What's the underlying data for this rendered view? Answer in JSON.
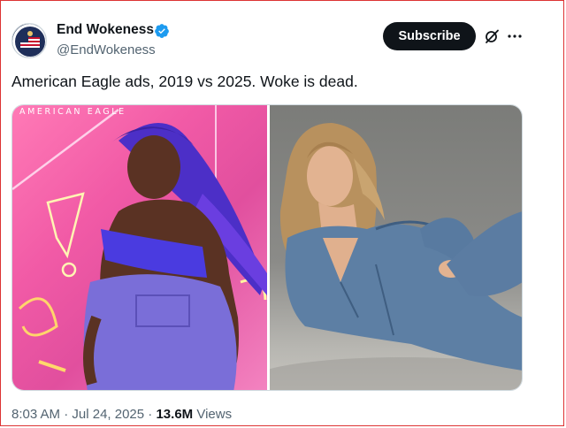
{
  "author": {
    "display_name": "End Wokeness",
    "handle": "@EndWokeness",
    "verified": true,
    "verified_color": "#1d9bf0"
  },
  "actions": {
    "subscribe_label": "Subscribe",
    "grok_icon": "grok-icon",
    "more_icon": "more-icon"
  },
  "tweet": {
    "text": "American Eagle ads, 2019 vs 2025. Woke is dead."
  },
  "media": {
    "left_brand_text": "AMERICAN EAGLE"
  },
  "meta": {
    "time": "8:03 AM",
    "date": "Jul 24, 2025",
    "views_count": "13.6M",
    "views_label": "Views"
  },
  "colors": {
    "text": "#0f1419",
    "secondary": "#536471",
    "button_bg": "#0f1419"
  }
}
